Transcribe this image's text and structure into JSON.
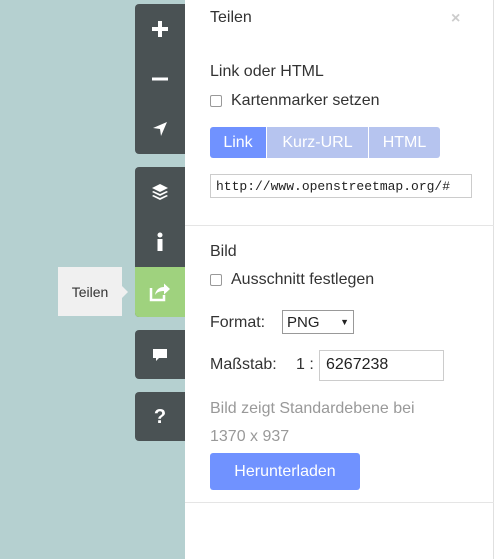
{
  "controls": {
    "zoom_in_icon": "plus-icon",
    "zoom_out_icon": "minus-icon",
    "locate_icon": "location-arrow-icon",
    "layers_icon": "layers-icon",
    "info_icon": "info-icon",
    "share_icon": "share-icon",
    "note_icon": "comment-icon",
    "help_label": "?",
    "active_color": "#9fd27e"
  },
  "tooltip": {
    "text": "Teilen"
  },
  "sidebar": {
    "title": "Teilen",
    "close_label": "×",
    "link_section": {
      "heading": "Link oder HTML",
      "marker_checkbox_label": "Kartenmarker setzen",
      "tabs": [
        {
          "label": "Link",
          "selected": true
        },
        {
          "label": "Kurz-URL",
          "selected": false
        },
        {
          "label": "HTML",
          "selected": false
        }
      ],
      "url_value": "http://www.openstreetmap.org/#"
    },
    "image_section": {
      "heading": "Bild",
      "area_checkbox_label": "Ausschnitt festlegen",
      "format_label": "Format:",
      "format_selected": "PNG",
      "scale_label": "Maßstab:",
      "scale_prefix": "1 :",
      "scale_value": "6267238",
      "info_line1": "Bild zeigt Standardebene bei",
      "info_line2": "1370 x 937",
      "download_label": "Herunterladen"
    }
  },
  "colors": {
    "accent": "#7092ff",
    "tab_inactive": "#b6c4ef",
    "map_background": "#b5d0d0"
  }
}
